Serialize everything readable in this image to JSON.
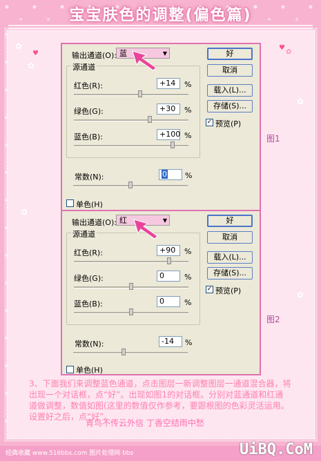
{
  "title": "宝宝肤色的调整(偏色篇)",
  "dialogs": [
    {
      "output_label": "输出通道(O):",
      "output_value": "蓝",
      "source_label": "源通道",
      "rows": [
        {
          "label": "红色(R):",
          "value": "+14",
          "unit": "%"
        },
        {
          "label": "绿色(G):",
          "value": "+30",
          "unit": "%"
        },
        {
          "label": "蓝色(B):",
          "value": "+100",
          "unit": "%"
        }
      ],
      "constant_label": "常数(N):",
      "constant_value": "0",
      "constant_unit": "%",
      "mono_label": "单色(H)",
      "ok": "好",
      "cancel": "取消",
      "load": "载入(L)...",
      "save": "存储(S)...",
      "preview": "预览(P)",
      "figure": "图1"
    },
    {
      "output_label": "输出通道(O):",
      "output_value": "红",
      "source_label": "源通道",
      "rows": [
        {
          "label": "红色(R):",
          "value": "+90",
          "unit": "%"
        },
        {
          "label": "绿色(G):",
          "value": "0",
          "unit": "%"
        },
        {
          "label": "蓝色(B):",
          "value": "0",
          "unit": "%"
        }
      ],
      "constant_label": "常数(N):",
      "constant_value": "-14",
      "constant_unit": "%",
      "mono_label": "单色(H)",
      "ok": "好",
      "cancel": "取消",
      "load": "载入(L)...",
      "save": "存储(S)...",
      "preview": "预览(P)",
      "figure": "图2"
    }
  ],
  "body_text": "3、下面我们来调整蓝色通道，点击图层一新调整图层一通道混合器，将出现一个对话框，点“好”。出现如图1的对话框。分别对蓝通道和红通道做调整，数值如图(这里的数值仅作参考，要跟根图的色彩灵活运用。设置好之后，点“好”。",
  "signature": "青鸟不传云外信  丁香空结雨中愁",
  "footer": "经典收藏 www.516bbs.com 图片处理网 bbs",
  "brand": "UiBQ.CoM",
  "colors": {
    "background": "#f7b3cf",
    "dialog": "#ece9d8",
    "accent": "#e070b0",
    "arrow": "#e8449a"
  }
}
